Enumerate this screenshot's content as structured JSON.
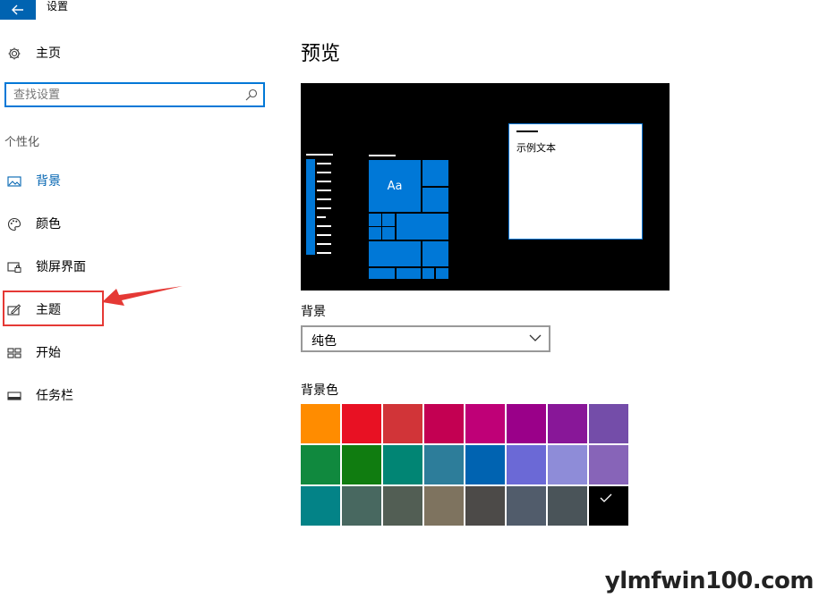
{
  "titlebar": {
    "back_icon": "back-arrow-icon",
    "title": "设置",
    "accent": "#0063b1"
  },
  "sidebar": {
    "home_label": "主页",
    "search": {
      "placeholder": "查找设置",
      "value": ""
    },
    "section": "个性化",
    "items": [
      {
        "label": "背景",
        "icon": "picture-icon",
        "selected": true
      },
      {
        "label": "颜色",
        "icon": "palette-icon",
        "selected": false
      },
      {
        "label": "锁屏界面",
        "icon": "lockscreen-icon",
        "selected": false
      },
      {
        "label": "主题",
        "icon": "theme-icon",
        "selected": false
      },
      {
        "label": "开始",
        "icon": "start-icon",
        "selected": false
      },
      {
        "label": "任务栏",
        "icon": "taskbar-icon",
        "selected": false
      }
    ]
  },
  "main": {
    "title": "预览",
    "preview_sample_text": "示例文本",
    "preview_tile_text": "Aa",
    "background_label": "背景",
    "background_value": "纯色",
    "color_label": "背景色",
    "swatches": [
      "#ff8c00",
      "#e81123",
      "#d13438",
      "#c30052",
      "#bf0077",
      "#9a0089",
      "#881798",
      "#744da9",
      "#10893e",
      "#107c10",
      "#018574",
      "#2d7d9a",
      "#0063b1",
      "#6b69d6",
      "#8e8cd8",
      "#8764b8",
      "#038387",
      "#486860",
      "#525e54",
      "#7e735f",
      "#4c4a48",
      "#515c6b",
      "#4a5459",
      "#000000"
    ],
    "selected_swatch": 23
  },
  "watermark": "ylmfwin100.com"
}
